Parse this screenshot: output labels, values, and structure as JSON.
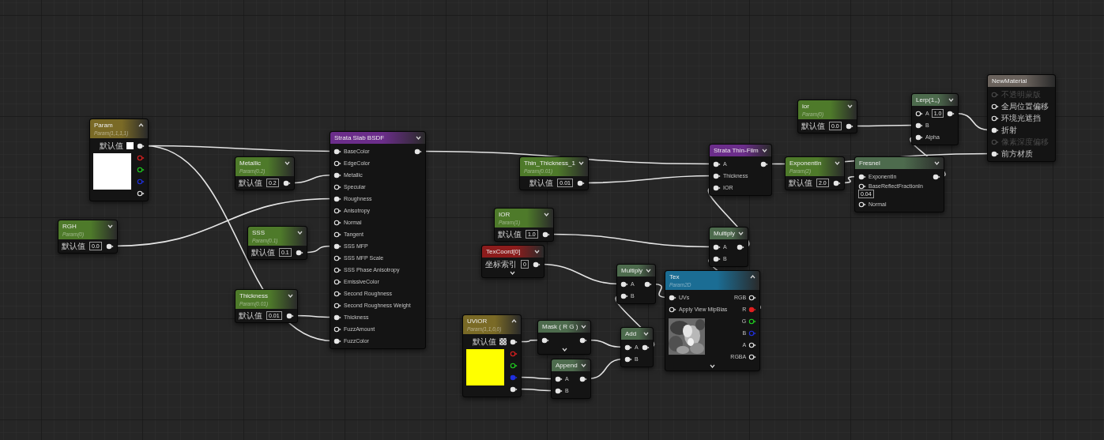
{
  "nodes": [
    {
      "kind": "vector",
      "title": "Param",
      "subtitle": "Param(1,1,1,1)",
      "color": "#7a6a26",
      "label": "默认值",
      "default_swatch": {
        "kind": "solid",
        "color": "#ffffff"
      },
      "preview": {
        "color": "#ffffff"
      },
      "outputs": [
        {
          "color": "#e6e6e6",
          "connected": true
        },
        {
          "color": "#e02020",
          "connected": false
        },
        {
          "color": "#20d020",
          "connected": false
        },
        {
          "color": "#2030e0",
          "connected": false
        },
        {
          "color": "#e6e6e6",
          "connected": false
        }
      ]
    },
    {
      "kind": "param",
      "title": "RGH",
      "subtitle": "Param(0)",
      "color": "#4e7a2a",
      "label": "默认值",
      "value": "0.0",
      "outputs": [
        {
          "connected": true
        }
      ]
    },
    {
      "kind": "param",
      "title": "Metallic",
      "subtitle": "Param(0.2)",
      "color": "#4e7a2a",
      "label": "默认值",
      "value": "0.2",
      "outputs": [
        {
          "connected": true
        }
      ]
    },
    {
      "kind": "param",
      "title": "SSS",
      "subtitle": "Param(0.1)",
      "color": "#4e7a2a",
      "label": "默认值",
      "value": "0.1",
      "outputs": [
        {
          "connected": true
        }
      ]
    },
    {
      "kind": "param",
      "title": "Thickness",
      "subtitle": "Param(0.01)",
      "color": "#4e7a2a",
      "label": "默认值",
      "value": "0.01",
      "outputs": [
        {
          "connected": true
        }
      ]
    },
    {
      "kind": "op",
      "title": "Strata Slab BSDF",
      "color": "#6b2d8a",
      "inputs": [
        {
          "label": "BaseColor",
          "connected": true
        },
        {
          "label": "EdgeColor",
          "connected": false
        },
        {
          "label": "Metallic",
          "connected": true
        },
        {
          "label": "Specular",
          "connected": false
        },
        {
          "label": "Roughness",
          "connected": true
        },
        {
          "label": "Anisotropy",
          "connected": false
        },
        {
          "label": "Normal",
          "connected": false
        },
        {
          "label": "Tangent",
          "connected": false
        },
        {
          "label": "SSS MFP",
          "connected": true
        },
        {
          "label": "SSS MFP Scale",
          "connected": false
        },
        {
          "label": "SSS Phase Anisotropy",
          "connected": false
        },
        {
          "label": "EmissiveColor",
          "connected": false
        },
        {
          "label": "Second Roughness",
          "connected": false
        },
        {
          "label": "Second Roughness Weight",
          "connected": false
        },
        {
          "label": "Thickness",
          "connected": true
        },
        {
          "label": "FuzzAmount",
          "connected": false
        },
        {
          "label": "FuzzColor",
          "connected": true
        }
      ],
      "outputs": [
        {
          "connected": true
        }
      ]
    },
    {
      "kind": "param",
      "title": "Thin_Thickness_1",
      "subtitle": "Param(0.01)",
      "color": "#4e7a2a",
      "label": "默认值",
      "value": "0.01",
      "outputs": [
        {
          "connected": true
        }
      ]
    },
    {
      "kind": "param",
      "title": "IOR",
      "subtitle": "Param(1)",
      "color": "#4e7a2a",
      "label": "默认值",
      "value": "1.0",
      "outputs": [
        {
          "connected": true
        }
      ]
    },
    {
      "kind": "param",
      "title": "TexCoord[0]",
      "color": "#8c1c1c",
      "label": "坐标索引",
      "value": "0",
      "expandable": true,
      "outputs": [
        {
          "connected": true
        }
      ]
    },
    {
      "kind": "vector",
      "title": "UVIOR",
      "subtitle": "Param(1,1,0,0)",
      "color": "#7a6a26",
      "label": "默认值",
      "default_swatch": {
        "kind": "checker"
      },
      "preview": {
        "color": "#ffff00"
      },
      "outputs": [
        {
          "color": "#e6e6e6",
          "connected": true
        },
        {
          "color": "#e02020",
          "connected": false
        },
        {
          "color": "#20d020",
          "connected": false
        },
        {
          "color": "#2030e0",
          "connected": true
        },
        {
          "color": "#e6e6e6",
          "connected": true
        }
      ]
    },
    {
      "kind": "op",
      "title": "Mask ( R G )",
      "color": "#4d6b4d",
      "expandable": true,
      "inputs": [
        {
          "connected": true
        }
      ],
      "outputs": [
        {
          "connected": true
        }
      ]
    },
    {
      "kind": "op",
      "title": "Append",
      "color": "#4d6b4d",
      "inputs": [
        {
          "label": "A",
          "connected": true
        },
        {
          "label": "B",
          "connected": true
        }
      ],
      "outputs": [
        {
          "connected": true
        }
      ]
    },
    {
      "kind": "op",
      "title": "Multiply",
      "color": "#4d6b4d",
      "inputs": [
        {
          "label": "A",
          "connected": true
        },
        {
          "label": "B",
          "connected": true
        }
      ],
      "outputs": [
        {
          "connected": true
        }
      ]
    },
    {
      "kind": "op",
      "title": "Add",
      "color": "#4d6b4d",
      "inputs": [
        {
          "label": "A",
          "connected": true
        },
        {
          "label": "B",
          "connected": true
        }
      ],
      "outputs": [
        {
          "connected": true
        }
      ]
    },
    {
      "kind": "op",
      "title": "Strata Thin-Film",
      "color": "#6b2d8a",
      "inputs": [
        {
          "label": "A",
          "connected": true
        },
        {
          "label": "Thickness",
          "connected": true
        },
        {
          "label": "IOR",
          "connected": true
        }
      ],
      "outputs": [
        {
          "connected": true
        }
      ]
    },
    {
      "kind": "op",
      "title": "Multiply",
      "color": "#4d6b4d",
      "inputs": [
        {
          "label": "A",
          "connected": true
        },
        {
          "label": "B",
          "connected": true
        }
      ],
      "outputs": [
        {
          "connected": true
        }
      ]
    },
    {
      "kind": "texture",
      "title": "Tex",
      "subtitle": "Param2D",
      "color": "#1b6d94",
      "expandable": true,
      "inputs": [
        {
          "label": "UVs",
          "connected": true
        },
        {
          "label": "Apply View MipBias",
          "connected": false
        }
      ],
      "outputs": [
        {
          "label": "RGB",
          "color": "#e6e6e6",
          "connected": false
        },
        {
          "label": "R",
          "color": "#e02020",
          "connected": true
        },
        {
          "label": "G",
          "color": "#20d020",
          "connected": false
        },
        {
          "label": "B",
          "color": "#2030e0",
          "connected": false
        },
        {
          "label": "A",
          "color": "#e6e6e6",
          "connected": false
        },
        {
          "label": "RGBA",
          "color": "#e6e6e6",
          "connected": false
        }
      ]
    },
    {
      "kind": "param",
      "title": "ior",
      "subtitle": "Param(0)",
      "color": "#4e7a2a",
      "label": "默认值",
      "value": "0.0",
      "outputs": [
        {
          "connected": true
        }
      ]
    },
    {
      "kind": "param",
      "title": "ExponentIn",
      "subtitle": "Param(2)",
      "color": "#4e7a2a",
      "label": "默认值",
      "value": "2.0",
      "outputs": [
        {
          "connected": true
        }
      ]
    },
    {
      "kind": "op",
      "title": "Fresnel",
      "color": "#4d6b4d",
      "inputs": [
        {
          "label": "ExponentIn",
          "connected": true
        },
        {
          "label": "BaseReflectFractionIn",
          "connected": false,
          "value": "0.04"
        },
        {
          "label": "Normal",
          "connected": false
        }
      ],
      "outputs": [
        {
          "connected": true
        }
      ]
    },
    {
      "kind": "op",
      "title": "Lerp(1,,)",
      "color": "#4d6b4d",
      "inputs": [
        {
          "label": "A",
          "connected": false,
          "value": "1.0"
        },
        {
          "label": "B",
          "connected": true
        },
        {
          "label": "Alpha",
          "connected": true
        }
      ],
      "outputs": [
        {
          "connected": true
        }
      ]
    },
    {
      "kind": "output",
      "title": "NewMaterial",
      "color": "#6a625c",
      "inputs": [
        {
          "label": "不透明蒙版",
          "connected": false,
          "disabled": true
        },
        {
          "label": "全局位置偏移",
          "connected": false,
          "disabled": false
        },
        {
          "label": "环境光遮挡",
          "connected": false,
          "disabled": false
        },
        {
          "label": "折射",
          "connected": true,
          "disabled": false
        },
        {
          "label": "像素深度偏移",
          "connected": false,
          "disabled": true
        },
        {
          "label": "前方材质",
          "connected": true,
          "disabled": false
        }
      ]
    }
  ]
}
